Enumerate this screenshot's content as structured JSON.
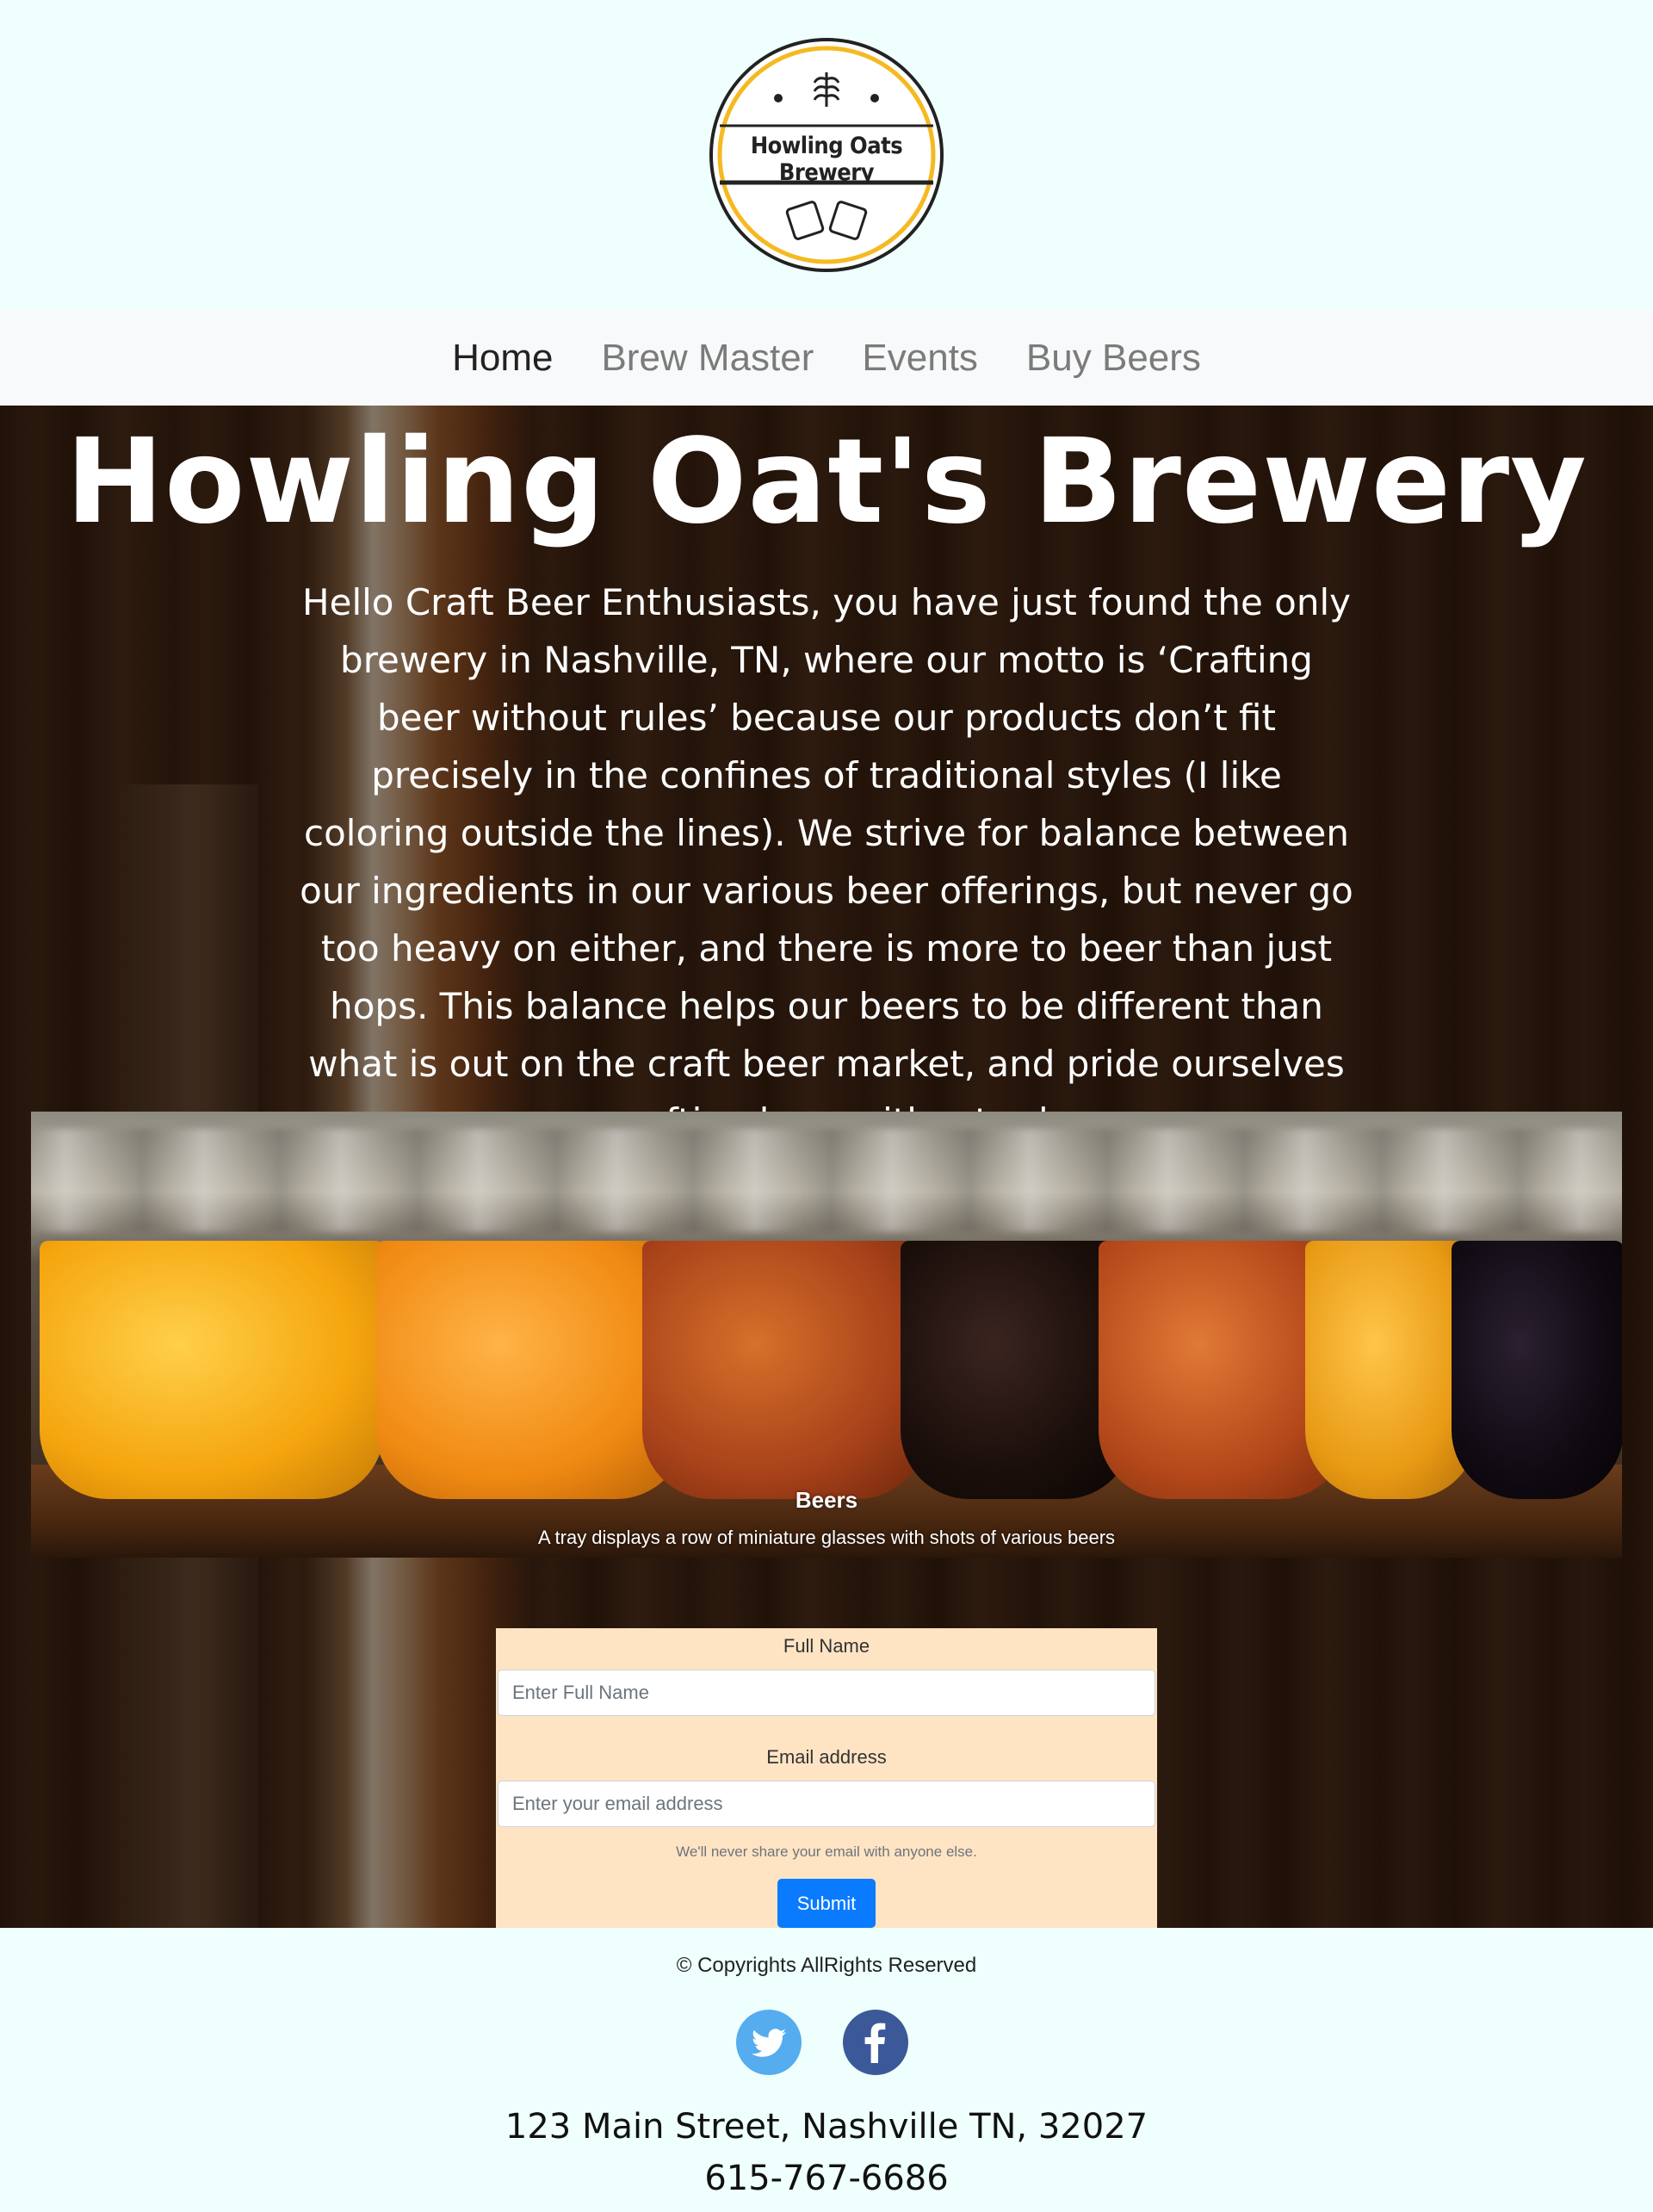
{
  "brand": {
    "logo_text": "Howling Oats Brewery"
  },
  "nav": {
    "items": [
      {
        "label": "Home",
        "active": true
      },
      {
        "label": "Brew Master",
        "active": false
      },
      {
        "label": "Events",
        "active": false
      },
      {
        "label": "Buy Beers",
        "active": false
      }
    ]
  },
  "hero": {
    "title": "Howling Oat's Brewery",
    "text": "Hello Craft Beer Enthusiasts, you have just found the only brewery in Nashville, TN, where our motto is ‘Crafting beer without rules’ because our products don’t fit precisely in the confines of traditional styles (I like coloring outside the lines). We strive for balance between our ingredients in our various beer offerings, but never go too heavy on either, and there is more to beer than just hops. This balance helps our beers to be different than what is out on the craft beer market, and pride ourselves on crafting beer without rules."
  },
  "carousel": {
    "caption_title": "Beers",
    "caption_text": "A tray displays a row of miniature glasses with shots of various beers"
  },
  "form": {
    "name_label": "Full Name",
    "name_placeholder": "Enter Full Name",
    "email_label": "Email address",
    "email_placeholder": "Enter your email address",
    "email_help": "We'll never share your email with anyone else.",
    "submit_label": "Submit"
  },
  "footer": {
    "copyright": "© Copyrights AllRights Reserved",
    "social": [
      {
        "icon": "twitter-icon",
        "color": "#55acee"
      },
      {
        "icon": "facebook-icon",
        "color": "#3b5998"
      }
    ],
    "address": "123 Main Street, Nashville TN, 32027",
    "phone": "615-767-6686"
  },
  "colors": {
    "page_bg": "#effffe",
    "nav_bg": "#f8f9fa",
    "form_bg": "#ffe4c4",
    "button": "#0a7bff"
  }
}
